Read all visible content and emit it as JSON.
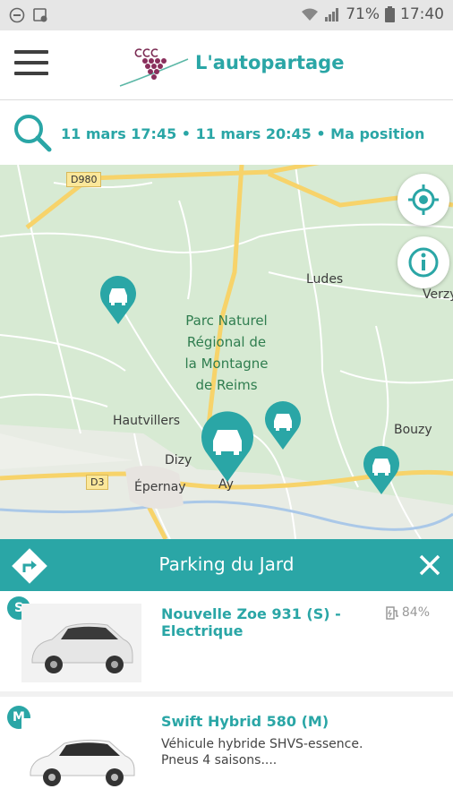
{
  "status_bar": {
    "battery_percent": "71%",
    "time": "17:40"
  },
  "header": {
    "title": "L'autopartage"
  },
  "search": {
    "summary": "11 mars 17:45 • 11 mars 20:45 • Ma position"
  },
  "map": {
    "places": [
      "Ludes",
      "Verzy",
      "Hautvillers",
      "Dizy",
      "Épernay",
      "Ay",
      "Bouzy"
    ],
    "park_label": [
      "Parc Naturel",
      "Régional de",
      "la Montagne",
      "de Reims"
    ],
    "road_badges": [
      "D980",
      "D3"
    ]
  },
  "parking": {
    "name": "Parking du Jard"
  },
  "vehicles": [
    {
      "category": "S",
      "name_line1": "Nouvelle Zoe 931 (S) -",
      "name_line2": "Electrique",
      "battery": "84%"
    },
    {
      "category": "M",
      "name_line1": "Swift Hybrid 580 (M)",
      "desc_line1": "Véhicule hybride SHVS-essence.",
      "desc_line2": "Pneus 4 saisons...."
    }
  ],
  "colors": {
    "accent": "#2aa6a6",
    "map_green": "#d7ead3",
    "road_yellow": "#f7d36a"
  }
}
